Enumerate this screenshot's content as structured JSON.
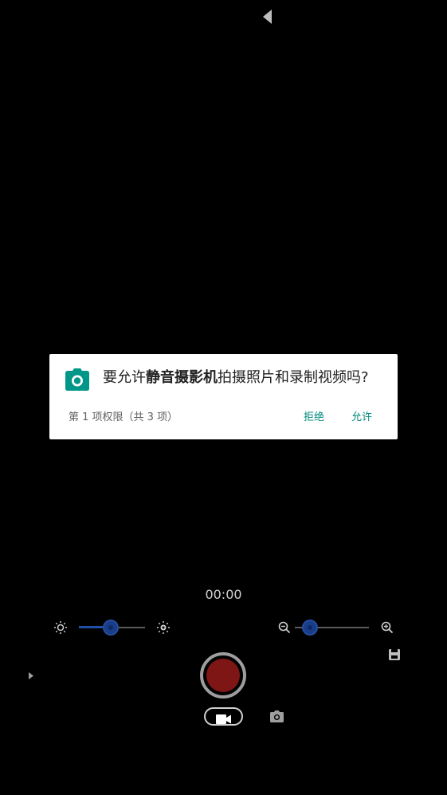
{
  "dialog": {
    "message_prefix": "要允许",
    "app_name": "静音摄影机",
    "message_suffix": "拍摄照片和录制视频吗?",
    "counter": "第 1 项权限（共 3 项）",
    "deny_label": "拒绝",
    "allow_label": "允许",
    "accent_color": "#009688"
  },
  "recorder": {
    "timer": "00:00",
    "brightness_level": 0.48,
    "zoom_level": 0.12,
    "record_color": "#7f1616",
    "slider_color": "#1f4fa8"
  },
  "icons": {
    "back": "back-arrow-icon",
    "permission": "camera-icon",
    "brightness_low": "brightness-low-icon",
    "brightness_high": "brightness-high-icon",
    "zoom_out": "zoom-out-icon",
    "zoom_in": "zoom-in-icon",
    "save": "save-icon",
    "expand": "expand-arrow-icon",
    "video_mode": "video-camera-icon",
    "photo_mode": "photo-camera-icon"
  }
}
